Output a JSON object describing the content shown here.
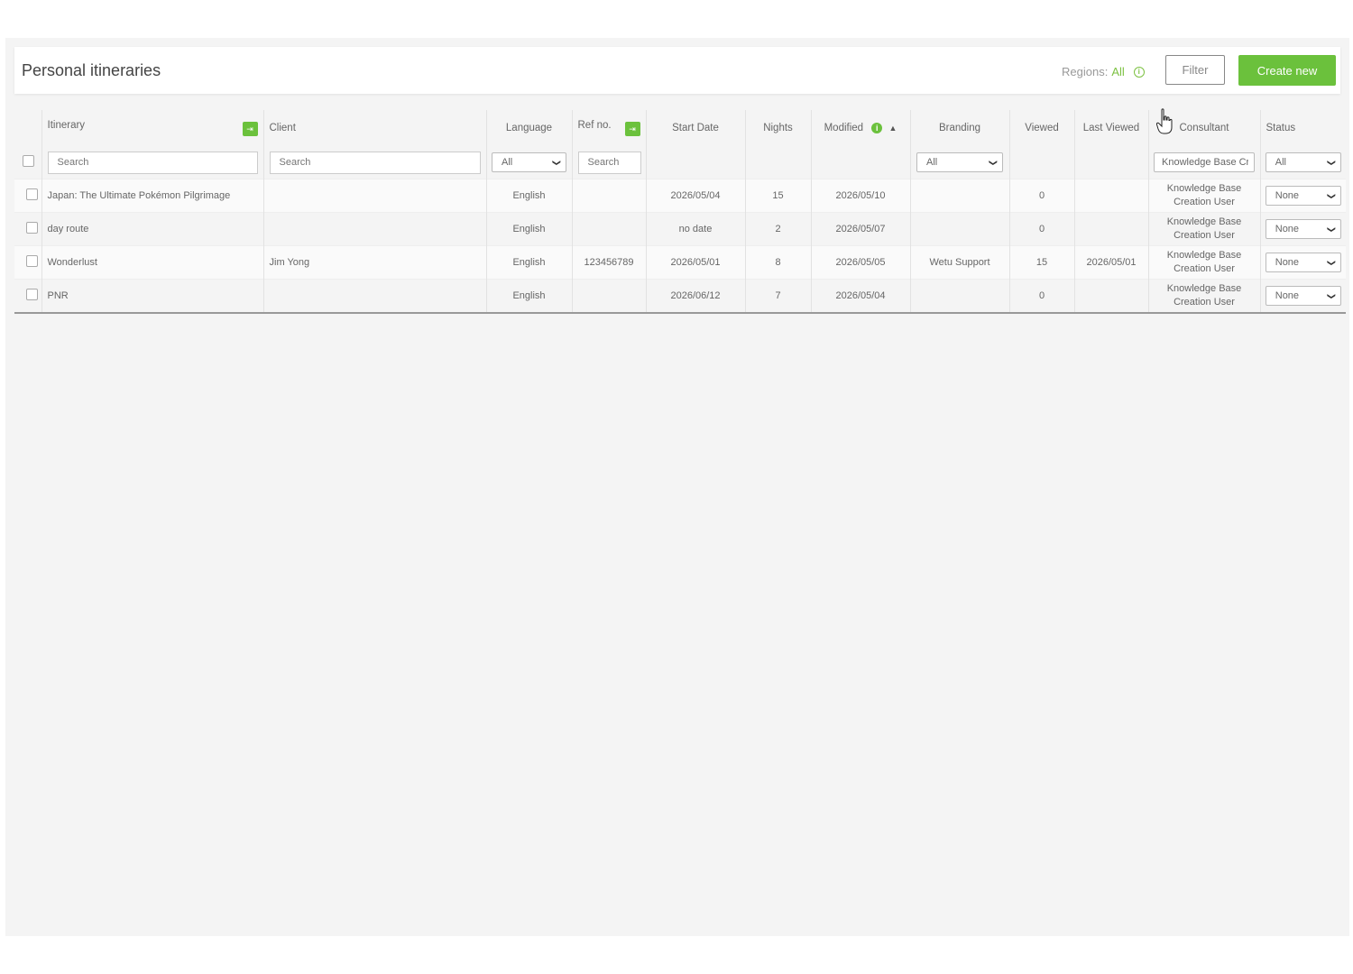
{
  "header": {
    "title": "Personal itineraries",
    "regions_label": "Regions:",
    "regions_value": "All",
    "filter_label": "Filter",
    "create_label": "Create new"
  },
  "columns": {
    "itinerary": "Itinerary",
    "client": "Client",
    "language": "Language",
    "ref_no": "Ref no.",
    "start_date": "Start Date",
    "nights": "Nights",
    "modified": "Modified",
    "branding": "Branding",
    "viewed": "Viewed",
    "last_viewed": "Last Viewed",
    "consultant": "Consultant",
    "status": "Status"
  },
  "filters": {
    "itinerary_placeholder": "Search",
    "client_placeholder": "Search",
    "language_value": "All",
    "ref_placeholder": "Search",
    "branding_value": "All",
    "consultant_value": "Knowledge Base Creation User",
    "status_value": "All"
  },
  "rows": [
    {
      "itinerary": "Japan: The Ultimate Pokémon Pilgrimage",
      "client": "",
      "language": "English",
      "ref": "",
      "start": "2026/05/04",
      "nights": "15",
      "modified": "2026/05/10",
      "branding": "",
      "viewed": "0",
      "last_viewed": "",
      "consultant": "Knowledge Base Creation User",
      "status": "None"
    },
    {
      "itinerary": "day route",
      "client": "",
      "language": "English",
      "ref": "",
      "start": "no date",
      "nights": "2",
      "modified": "2026/05/07",
      "branding": "",
      "viewed": "0",
      "last_viewed": "",
      "consultant": "Knowledge Base Creation User",
      "status": "None"
    },
    {
      "itinerary": "Wonderlust",
      "client": "Jim Yong",
      "language": "English",
      "ref": "123456789",
      "start": "2026/05/01",
      "nights": "8",
      "modified": "2026/05/05",
      "branding": "Wetu Support",
      "viewed": "15",
      "last_viewed": "2026/05/01",
      "consultant": "Knowledge Base Creation User",
      "status": "None"
    },
    {
      "itinerary": "PNR",
      "client": "",
      "language": "English",
      "ref": "",
      "start": "2026/06/12",
      "nights": "7",
      "modified": "2026/05/04",
      "branding": "",
      "viewed": "0",
      "last_viewed": "",
      "consultant": "Knowledge Base Creation User",
      "status": "None"
    }
  ],
  "colors": {
    "accent": "#6bc13c",
    "background": "#f4f4f4"
  }
}
